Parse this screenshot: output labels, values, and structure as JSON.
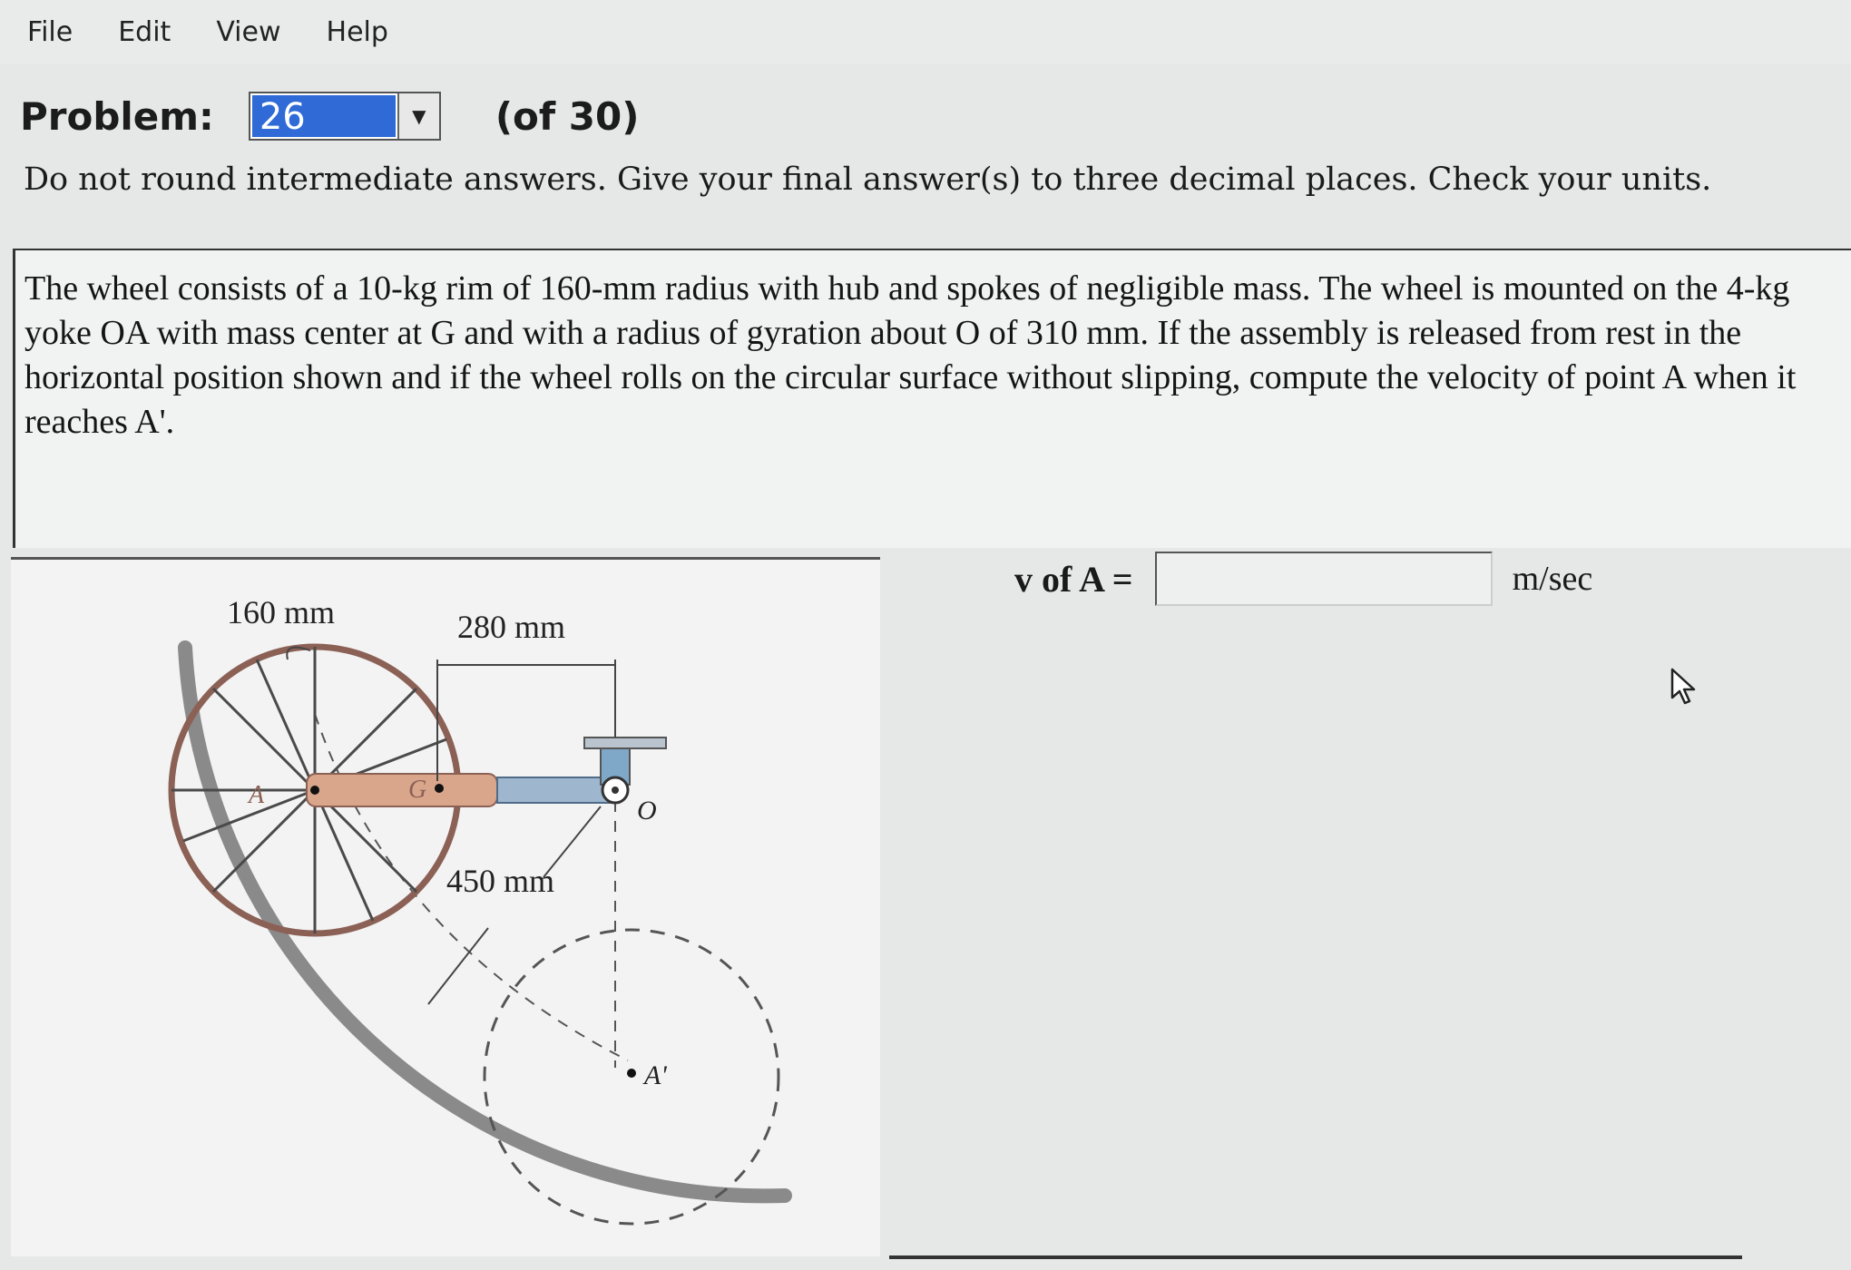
{
  "menu": [
    "File",
    "Edit",
    "View",
    "Help"
  ],
  "problem": {
    "label": "Problem:",
    "selected": "26",
    "total": "(of 30)"
  },
  "instructions": "Do not round intermediate answers. Give your final answer(s) to three decimal places. Check your units.",
  "statement": "The wheel consists of a 10-kg rim of 160-mm radius with hub and spokes of negligible mass. The wheel is mounted on the 4-kg yoke OA with mass center at G and with a radius of gyration about O of 310 mm. If the assembly is released from rest in the horizontal position shown and if the wheel rolls on the circular surface without slipping, compute the velocity of point A when it reaches A'.",
  "figure": {
    "dim_radius": "160 mm",
    "dim_offset": "280 mm",
    "dim_arm": "450 mm",
    "label_A": "A",
    "label_G": "G",
    "label_O": "O",
    "label_A_prime": "A'"
  },
  "answer": {
    "label": "v of A =",
    "value": "",
    "unit": "m/sec"
  },
  "colors": {
    "selection": "#2f6ad6",
    "rim": "#8b6055",
    "yoke": "#d9a68b",
    "shaft": "#9fb6cf"
  }
}
